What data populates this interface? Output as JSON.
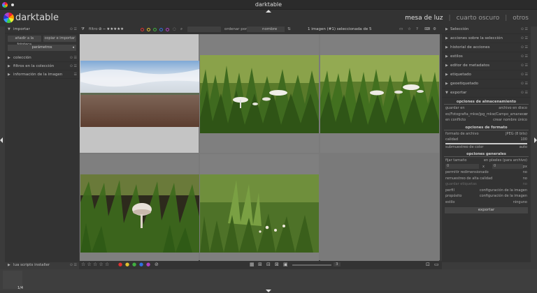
{
  "window": {
    "title": "darktable"
  },
  "app": {
    "brand": "darktable"
  },
  "views": [
    "mesa de luz",
    "cuarto oscuro",
    "otros"
  ],
  "left_panel": {
    "import_header": "importar",
    "add_button": "añadir a la fototeca",
    "copy_button": "copiar e importar",
    "params": "parámetros",
    "modules": [
      "colección",
      "filtros en la colección",
      "información de la imagen"
    ],
    "bottom_module": "lua scripts installer"
  },
  "toolbar": {
    "filter_label": "filtro",
    "sort_label": "ordenar por",
    "sort_value": "nombre",
    "selection_count": "1 imagen (#1) seleccionada de 5",
    "color_labels": [
      "#e03030",
      "#e0c030",
      "#40b040",
      "#3070e0",
      "#b040c0"
    ]
  },
  "right_panel": {
    "modules": [
      "Selección",
      "acciones sobre la selección",
      "historial de acciones",
      "estilos",
      "editor de metadatos",
      "etiquetado",
      "geoetiquetado",
      "exportar"
    ],
    "storage_section": "opciones de almacenamiento",
    "save_label": "guardar en",
    "save_value": "archivo en disco",
    "path_value": "es/Fotografia_mkw/jpg_mkw/Campo_amanecer",
    "conflict_label": "en conflicto",
    "conflict_value": "crear nombre único",
    "format_section": "opciones de formato",
    "file_format_label": "formato de archivo",
    "file_format_value": "JPEG (8 bits)",
    "quality_label": "calidad",
    "quality_value": "100",
    "quality_fraction": 1.0,
    "subsampling_label": "submuestreo de color",
    "subsampling_value": "auto",
    "general_section": "opciones generales",
    "size_label": "fijar tamaño",
    "size_value": "en píxeles (para archivo)",
    "width_value": "0",
    "times": "x",
    "height_value": "0",
    "unit": "px",
    "upscale_label": "permitir redimensionado",
    "upscale_value": "no",
    "hq_label": "remuestreo de alta calidad",
    "hq_value": "no",
    "tags_label": "guardar etiquetas",
    "tags_value": "no",
    "profile_label": "perfil",
    "profile_value": "configuración de la imagen",
    "intent_label": "propósito",
    "intent_value": "configuración de la imagen",
    "style_label": "estilo",
    "style_value": "ninguno",
    "export_button": "exportar"
  },
  "bottom_toolbar": {
    "stars": "☆ ☆ ☆ ☆ ☆",
    "zoom_value": "3"
  },
  "filmstrip": {
    "page": "1/4"
  }
}
